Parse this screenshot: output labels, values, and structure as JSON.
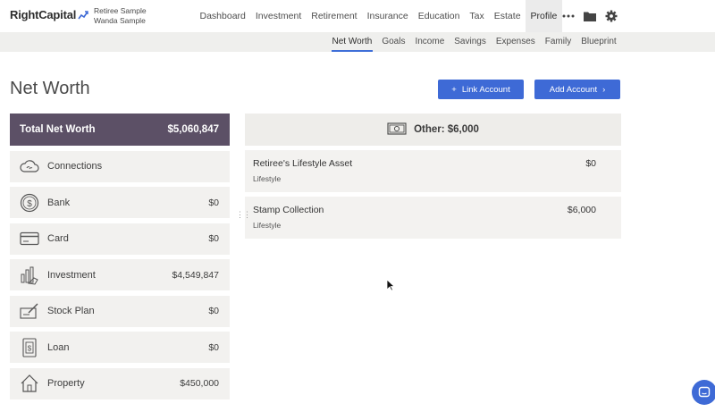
{
  "header": {
    "logo": "RightCapital",
    "client_line1": "Retiree Sample",
    "client_line2": "Wanda Sample",
    "nav": [
      "Dashboard",
      "Investment",
      "Retirement",
      "Insurance",
      "Education",
      "Tax",
      "Estate",
      "Profile"
    ],
    "active_nav": "Profile",
    "icons": [
      "more-icon",
      "folder-icon",
      "gear-icon"
    ]
  },
  "subnav": {
    "items": [
      "Net Worth",
      "Goals",
      "Income",
      "Savings",
      "Expenses",
      "Family",
      "Blueprint"
    ],
    "active": "Net Worth"
  },
  "page": {
    "title": "Net Worth",
    "link_account_label": "Link Account",
    "add_account_label": "Add Account"
  },
  "summary": {
    "total_label": "Total Net Worth",
    "total_value": "$5,060,847",
    "accounts": [
      {
        "name": "Connections",
        "value": "",
        "icon": "cloud-icon"
      },
      {
        "name": "Bank",
        "value": "$0",
        "icon": "dollar-coin-icon"
      },
      {
        "name": "Card",
        "value": "$0",
        "icon": "credit-card-icon"
      },
      {
        "name": "Investment",
        "value": "$4,549,847",
        "icon": "chart-hand-icon"
      },
      {
        "name": "Stock Plan",
        "value": "$0",
        "icon": "check-pen-icon"
      },
      {
        "name": "Loan",
        "value": "$0",
        "icon": "loan-doc-icon"
      },
      {
        "name": "Property",
        "value": "$450,000",
        "icon": "house-icon"
      }
    ]
  },
  "detail": {
    "header": "Other: $6,000",
    "header_icon": "cash-bill-icon",
    "assets": [
      {
        "name": "Retiree's Lifestyle Asset",
        "value": "$0",
        "category": "Lifestyle"
      },
      {
        "name": "Stamp Collection",
        "value": "$6,000",
        "category": "Lifestyle"
      }
    ]
  },
  "colors": {
    "accent": "#3e6ad6",
    "total_bg": "#5c5066",
    "card_bg": "#f2f1ef"
  }
}
